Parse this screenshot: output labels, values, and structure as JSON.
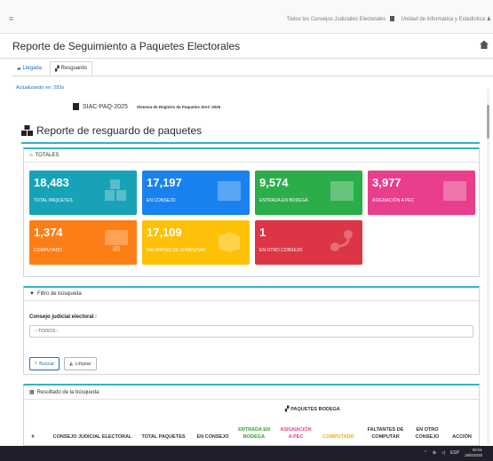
{
  "topbar": {
    "menu_icon": "hamburger-icon",
    "consejos_link": "Todos los Consejos Judiciales Electorales",
    "unidad_link": "Unidad de Informática y Estadística"
  },
  "page": {
    "title": "Reporte de Seguimiento a Paquetes Electorales"
  },
  "tabs": [
    {
      "label": "Llegada",
      "icon": "truck-icon"
    },
    {
      "label": "Resguardo",
      "icon": "boxes-icon"
    }
  ],
  "updated_text": "Actualizando en: 293s",
  "brand": {
    "code": "SIAC-PAQ-2025",
    "name": "Sistema de Registro de Paquetes SIAC 2025"
  },
  "report": {
    "title": "Reporte de resguardo de paquetes"
  },
  "totales": {
    "header": "TOTALES",
    "tiles": [
      {
        "value": "18,483",
        "label": "TOTAL PAQUETES",
        "color": "#17a2b8"
      },
      {
        "value": "17,197",
        "label": "EN CONSEJO",
        "color": "#1a82f0"
      },
      {
        "value": "9,574",
        "label": "ENTRADA EN BODEGA",
        "color": "#2bad4a"
      },
      {
        "value": "3,977",
        "label": "ASIGNACIÓN A PEC",
        "color": "#e83e8c"
      },
      {
        "value": "1,374",
        "label": "COMPUTADO",
        "color": "#fd7e14"
      },
      {
        "value": "17,109",
        "label": "FALTANTES DE COMPUTAR",
        "color": "#ffc107"
      },
      {
        "value": "1",
        "label": "EN OTRO CONSEJO",
        "color": "#dc3545"
      }
    ]
  },
  "filtro": {
    "header": "Filtro de búsqueda",
    "consejo_label": "Consejo judicial electoral :",
    "consejo_value": "--TODOS--",
    "buscar_label": "Buscar",
    "limpiar_label": "Limpiar"
  },
  "resultado": {
    "header": "Resultado de la búsqueda",
    "group_header": "PAQUETES BODEGA",
    "columns": {
      "num": "#",
      "consejo": "CONSEJO JUDICIAL ELECTORAL",
      "total": "TOTAL PAQUETES",
      "en_consejo": "EN CONSEJO",
      "entrada": "ENTRADA EN BODEGA",
      "asignacion": "ASIGNACIÓN A PEC",
      "computado": "COMPUTADO",
      "faltantes": "FALTANTES DE COMPUTAR",
      "otro": "EN OTRO CONSEJO",
      "accion": "ACCIÓN"
    }
  },
  "taskbar": {
    "lang": "ESP",
    "time": "00:01",
    "date": "18/5/2025"
  }
}
